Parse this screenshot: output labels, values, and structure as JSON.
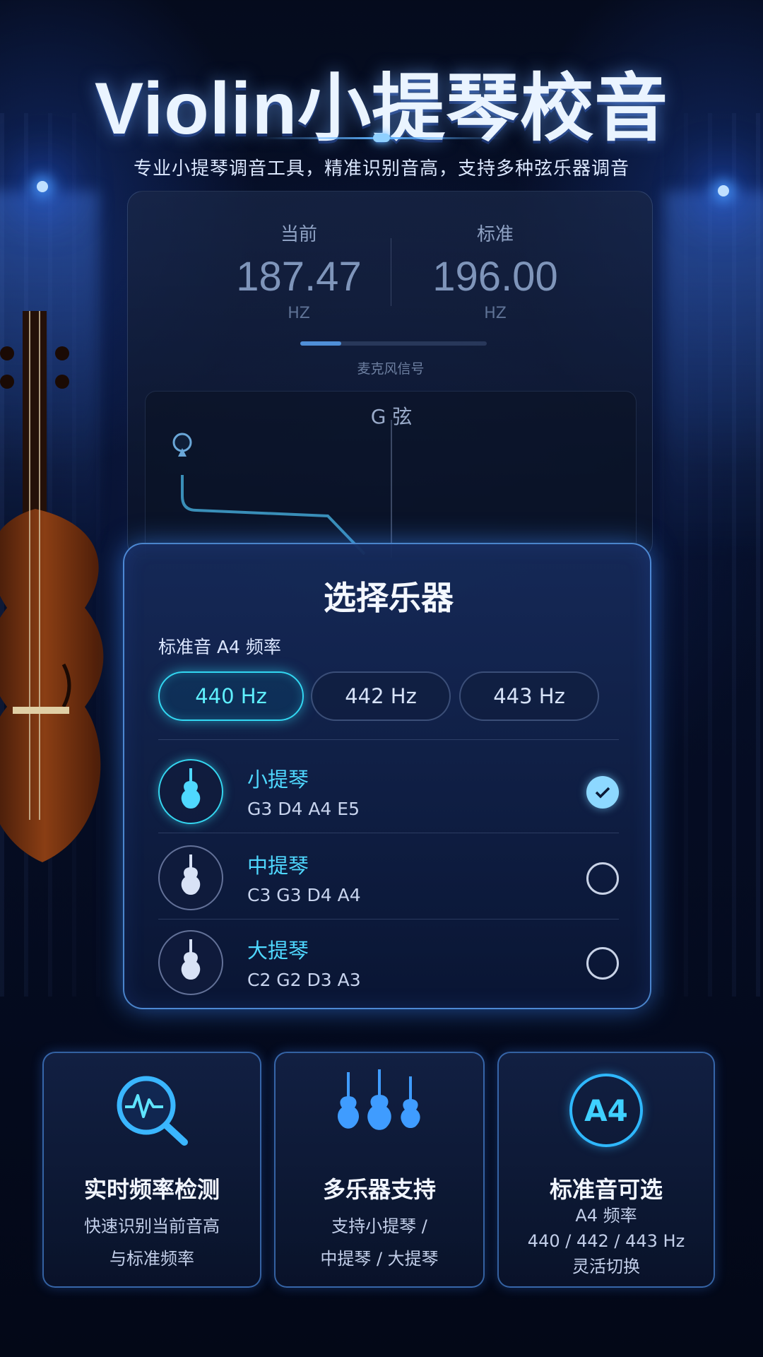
{
  "header": {
    "title": "Violin小提琴校音",
    "subtitle": "专业小提琴调音工具，精准识别音高，支持多种弦乐器调音"
  },
  "tuner": {
    "current_label": "当前",
    "current_value": "187.47",
    "current_unit": "HZ",
    "standard_label": "标准",
    "standard_value": "196.00",
    "standard_unit": "HZ",
    "mic_label": "麦克风信号",
    "mic_level": 0.22,
    "string_label": "G 弦"
  },
  "modal": {
    "title": "选择乐器",
    "freq_label": "标准音 A4 频率",
    "freq_options": [
      "440 Hz",
      "442 Hz",
      "443 Hz"
    ],
    "freq_selected": "440 Hz",
    "instruments": [
      {
        "name": "小提琴",
        "notes": "G3 D4 A4 E5",
        "selected": true
      },
      {
        "name": "中提琴",
        "notes": "C3 G3 D4 A4",
        "selected": false
      },
      {
        "name": "大提琴",
        "notes": "C2 G2 D3 A3",
        "selected": false
      }
    ]
  },
  "features": [
    {
      "title": "实时频率检测",
      "desc": [
        "快速识别当前音高",
        "与标准频率"
      ],
      "icon": "frequency-search-icon"
    },
    {
      "title": "多乐器支持",
      "desc": [
        "支持小提琴 /",
        "中提琴 / 大提琴"
      ],
      "icon": "instruments-icon"
    },
    {
      "title": "标准音可选",
      "desc": [
        "A4 频率",
        "440 / 442 / 443 Hz",
        "灵活切换"
      ],
      "icon_text": "A4",
      "icon": "a4-badge-icon"
    }
  ],
  "colors": {
    "accent": "#35d6f0",
    "brand_blue": "#4f8fd8",
    "background": "#06102a"
  }
}
